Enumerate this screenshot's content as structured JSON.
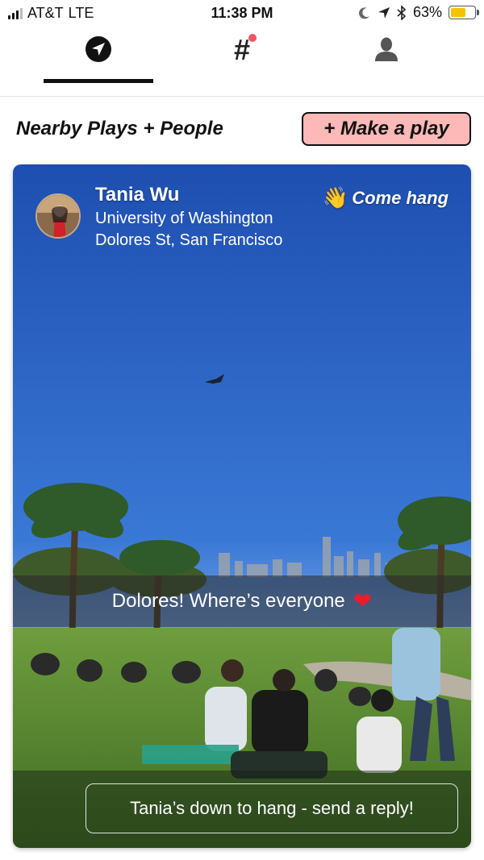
{
  "status": {
    "carrier": "AT&T",
    "network": "LTE",
    "time": "11:38 PM",
    "battery": "63%",
    "battery_level": 0.63
  },
  "tabs": [
    {
      "icon": "location-arrow-icon",
      "active": true
    },
    {
      "icon": "hashtag-icon",
      "label": "#",
      "has_notification": true
    },
    {
      "icon": "profile-icon"
    }
  ],
  "header": {
    "title": "Nearby Plays + People",
    "make_play_label": "+ Make a play"
  },
  "card": {
    "name": "Tania Wu",
    "school": "University of Washington",
    "location": "Dolores St, San Francisco",
    "vibe_emoji": "👋",
    "vibe_label": "Come hang",
    "caption": "Dolores! Where’s everyone",
    "caption_emoji": "❤",
    "reply_label": "Tania’s down to hang - send a reply!"
  },
  "colors": {
    "accent_button": "#fdb8b8",
    "notification_dot": "#f05563",
    "battery": "#f4c400"
  }
}
